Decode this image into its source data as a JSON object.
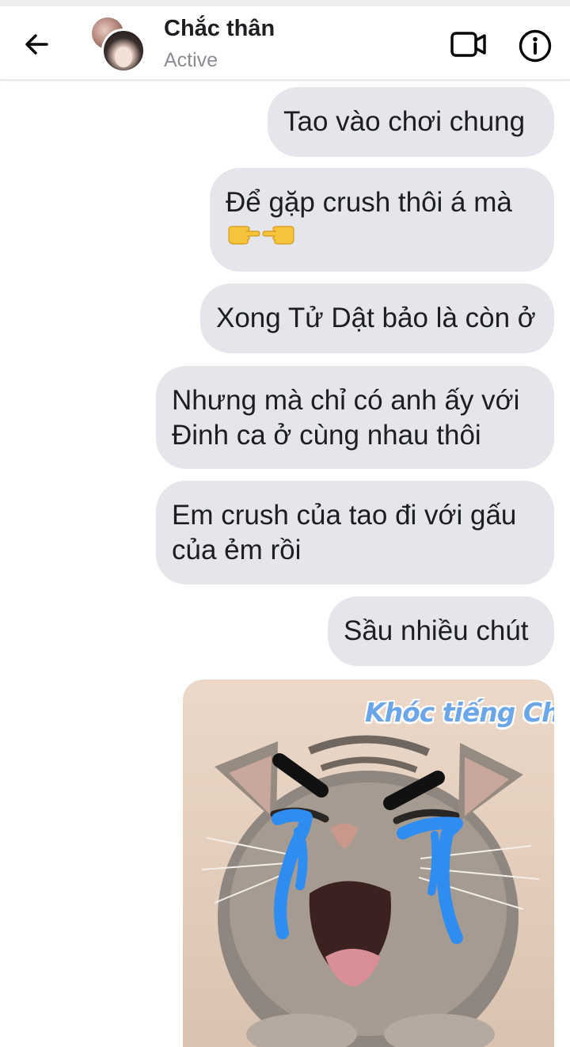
{
  "header": {
    "contact_name": "Chắc thân",
    "status": "Active",
    "icons": {
      "back": "arrow-left-icon",
      "video": "video-camera-icon",
      "info": "info-icon"
    }
  },
  "messages": [
    {
      "lines": [
        "Tao vào chơi chung"
      ]
    },
    {
      "lines": [
        "Để gặp crush thôi á mà"
      ],
      "emoji": [
        "👉",
        "👈"
      ]
    },
    {
      "lines": [
        "Xong Tử Dật bảo là còn ở"
      ]
    },
    {
      "lines": [
        "Nhưng mà chỉ có anh ấy với",
        "Đinh ca ở cùng nhau thôi"
      ]
    },
    {
      "lines": [
        "Em crush của tao đi với gấu",
        "của ẻm rồi"
      ]
    },
    {
      "lines": [
        "Sầu nhiều chút"
      ]
    }
  ],
  "sticker": {
    "caption": "Khóc tiếng Chó",
    "subject": "crying-cat-sticker"
  },
  "colors": {
    "bubble": "#e4e6eb",
    "status_text": "#8a8d91",
    "tear": "#2f8cf0",
    "caption": "#6aa6e8"
  }
}
